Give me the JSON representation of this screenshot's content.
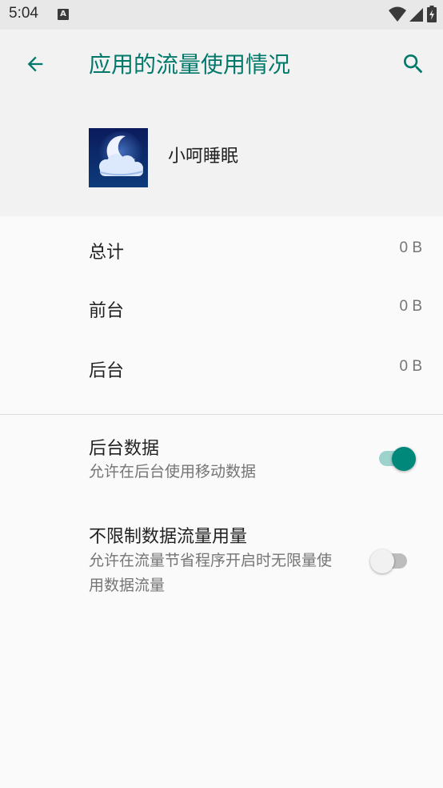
{
  "status_bar": {
    "time": "5:04",
    "notification_icon": "a-notification-icon",
    "wifi_icon": "wifi-icon",
    "signal_icon": "cell-signal-icon",
    "battery_icon": "battery-charging-icon"
  },
  "app_bar": {
    "title": "应用的流量使用情况",
    "back_icon": "arrow-back-icon",
    "search_icon": "search-icon",
    "accent_color": "#00796b"
  },
  "app": {
    "name": "小呵睡眠",
    "icon": "moon-cloud-app-icon"
  },
  "usage": [
    {
      "label": "总计",
      "value": "0 B"
    },
    {
      "label": "前台",
      "value": "0 B"
    },
    {
      "label": "后台",
      "value": "0 B"
    }
  ],
  "preferences": [
    {
      "title": "后台数据",
      "summary": "允许在后台使用移动数据",
      "enabled": true
    },
    {
      "title": "不限制数据流量用量",
      "summary": "允许在流量节省程序开启时无限量使用数据流量",
      "enabled": false
    }
  ]
}
